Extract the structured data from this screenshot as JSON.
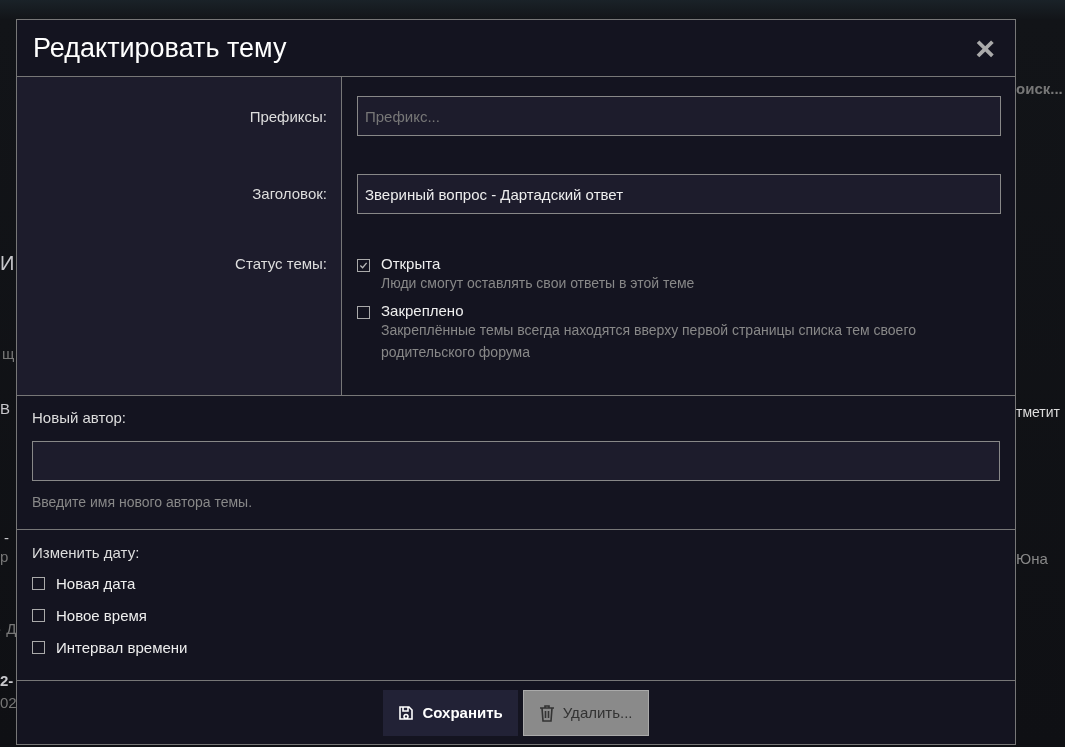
{
  "background": {
    "left_fragments": [
      "И",
      "щ",
      "В",
      "-",
      "р",
      "· Д",
      "2-",
      "02"
    ],
    "right_fragments": [
      "оиск...",
      "тметит",
      "Юна"
    ]
  },
  "dialog": {
    "title": "Редактировать тему",
    "close": "×",
    "fields": [
      {
        "label": "Префиксы:",
        "placeholder": "Префикс..."
      },
      {
        "label": "Заголовок:",
        "value": "Звериный вопрос - Дартадский ответ"
      }
    ],
    "status": {
      "label": "Статус темы:",
      "options": [
        {
          "label": "Открыта",
          "hint": "Люди смогут оставлять свои ответы в этой теме",
          "checked": true
        },
        {
          "label": "Закреплено",
          "hint": "Закреплённые темы всегда находятся вверху первой страницы списка тем своего родительского форума",
          "checked": false
        }
      ]
    },
    "new_author": {
      "label": "Новый автор:",
      "hint": "Введите имя нового автора темы."
    },
    "change_date": {
      "label": "Изменить дату:",
      "options": [
        {
          "label": "Новая дата",
          "checked": false
        },
        {
          "label": "Новое время",
          "checked": false
        },
        {
          "label": "Интервал времени",
          "checked": false
        }
      ]
    },
    "buttons": [
      {
        "kind": "save",
        "label": "Сохранить"
      },
      {
        "kind": "delete",
        "label": "Удалить..."
      }
    ]
  }
}
